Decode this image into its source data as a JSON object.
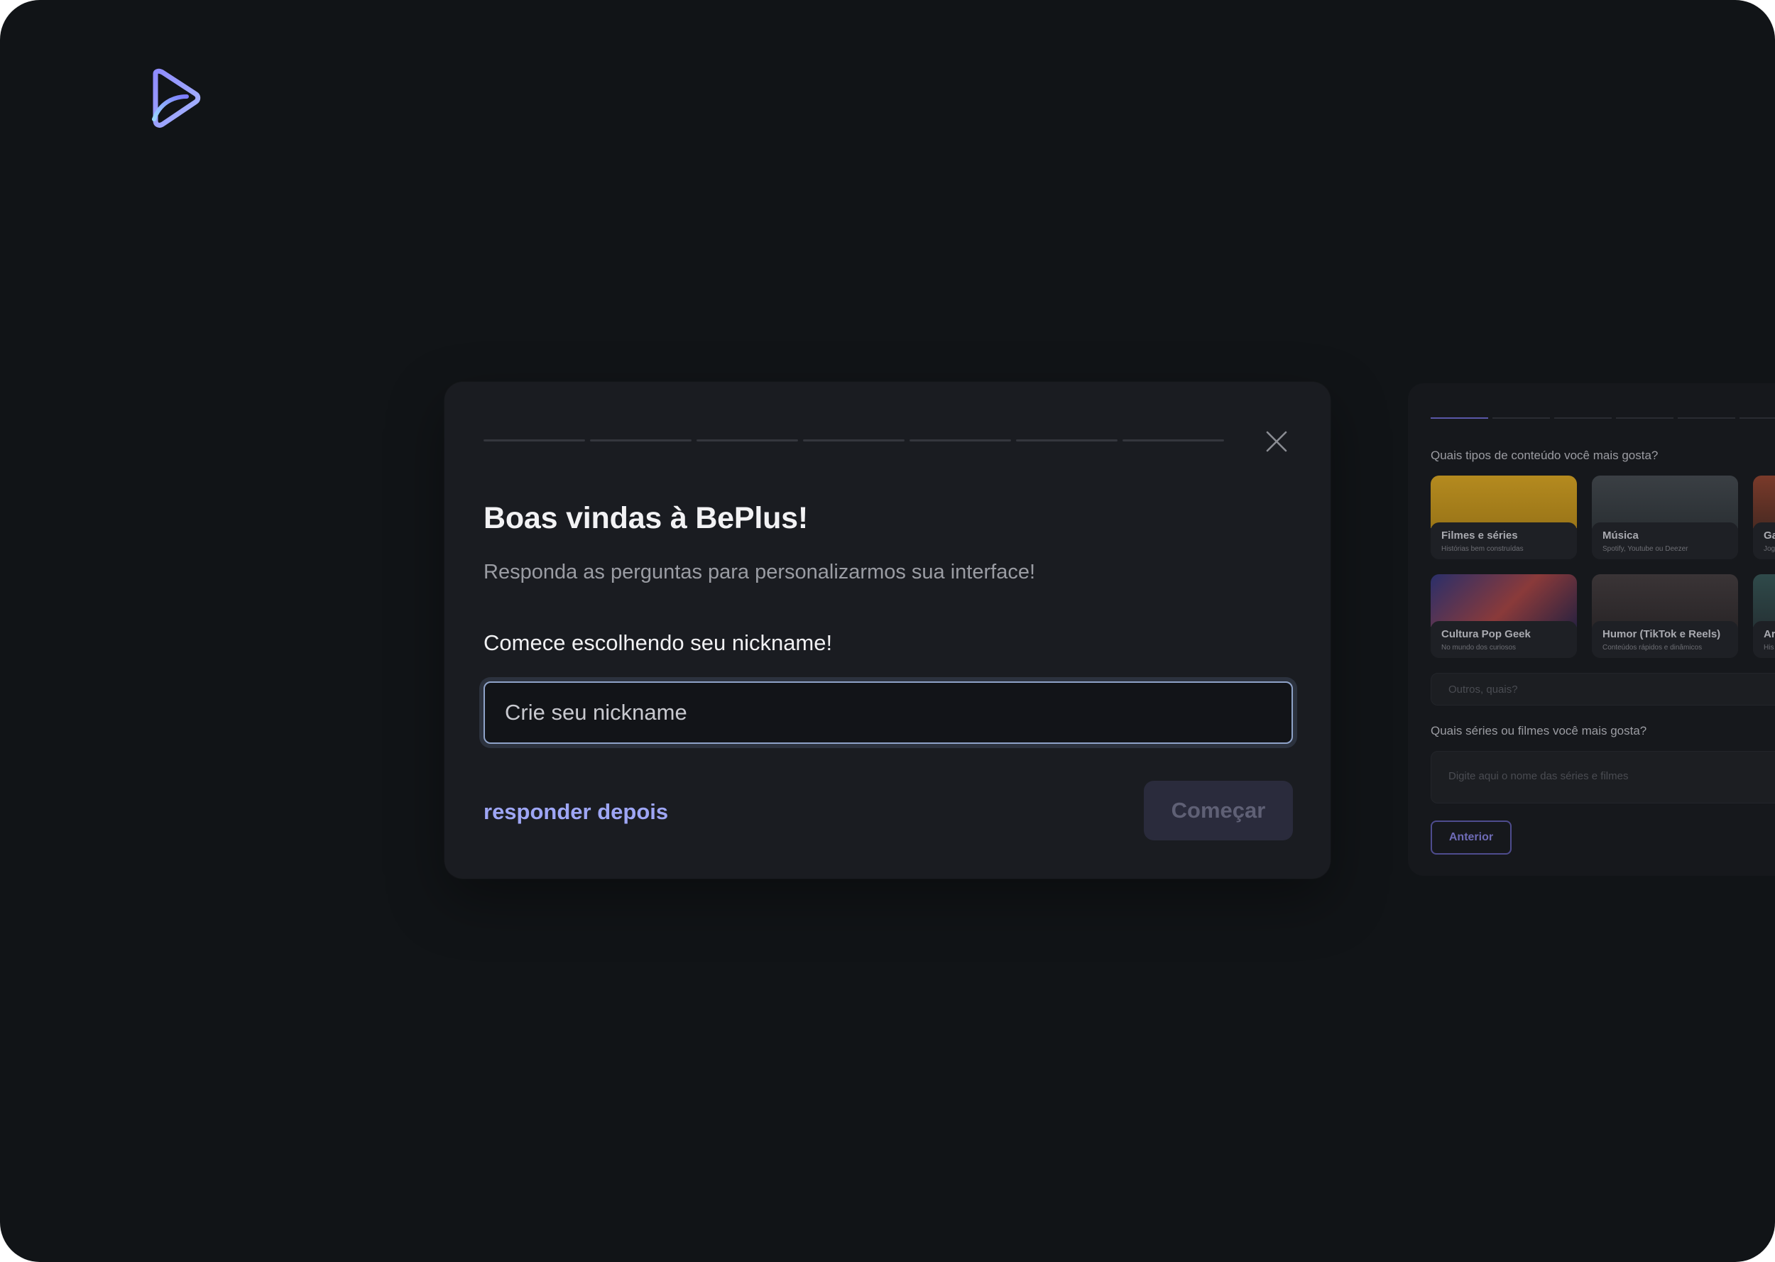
{
  "app": {
    "logo_icon": "play-triangle-logo-icon"
  },
  "onboarding": {
    "progress_steps": 7,
    "title": "Boas vindas à BePlus!",
    "subtitle": "Responda as perguntas para personalizarmos sua interface!",
    "prompt": "Comece escolhendo seu nickname!",
    "nickname": {
      "value": "",
      "placeholder": "Crie seu nickname"
    },
    "later_label": "responder depois",
    "start_label": "Começar",
    "close_icon": "close-icon"
  },
  "next_step": {
    "question_content": "Quais tipos de conteúdo você mais gosta?",
    "cards": [
      {
        "name": "Filmes e séries",
        "desc": "Histórias bem construídas"
      },
      {
        "name": "Música",
        "desc": "Spotify, Youtube ou Deezer"
      },
      {
        "name": "Ga",
        "desc": "Jog"
      },
      {
        "name": "Cultura Pop Geek",
        "desc": "No mundo dos curiosos"
      },
      {
        "name": "Humor (TikTok e Reels)",
        "desc": "Conteúdos rápidos e dinâmicos"
      },
      {
        "name": "Ar",
        "desc": "His"
      }
    ],
    "other_placeholder": "Outros, quais?",
    "question_series": "Quais séries ou filmes você mais gosta?",
    "series_placeholder": "Digite aqui o nome das séries e filmes",
    "previous_label": "Anterior"
  },
  "colors": {
    "background": "#111417",
    "modal": "#1a1c21",
    "accent": "#9ea6f5",
    "input_border": "#8fa3c9"
  }
}
